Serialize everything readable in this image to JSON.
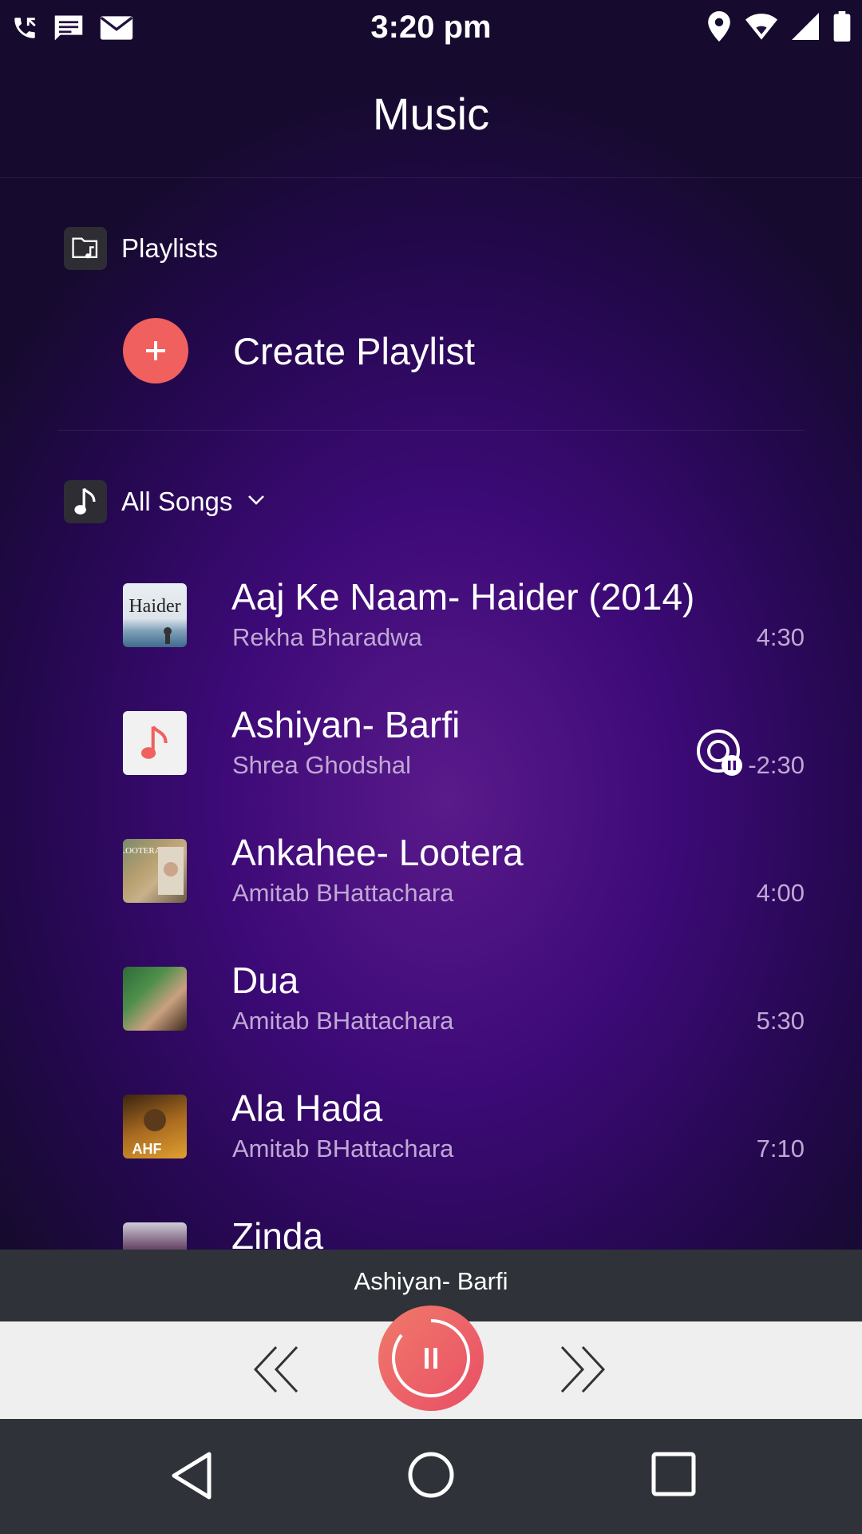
{
  "status_bar": {
    "time": "3:20 pm",
    "left_icons": [
      "phone-call-icon",
      "message-icon",
      "mail-icon"
    ],
    "right_icons": [
      "location-icon",
      "wifi-icon",
      "signal-icon",
      "battery-icon"
    ]
  },
  "app_bar": {
    "title": "Music"
  },
  "playlists": {
    "section_label": "Playlists",
    "create_label": "Create Playlist"
  },
  "songs_section": {
    "label": "All Songs"
  },
  "songs": [
    {
      "title": "Aaj Ke Naam- Haider (2014)",
      "artist": "Rekha Bharadwa",
      "duration": "4:30"
    },
    {
      "title": "Ashiyan- Barfi",
      "artist": "Shrea Ghodshal",
      "duration": "-2:30",
      "playing": true
    },
    {
      "title": "Ankahee- Lootera",
      "artist": "Amitab BHattachara",
      "duration": "4:00"
    },
    {
      "title": "Dua",
      "artist": "Amitab BHattachara",
      "duration": "5:30"
    },
    {
      "title": "Ala Hada",
      "artist": "Amitab BHattachara",
      "duration": "7:10"
    },
    {
      "title": "Zinda",
      "artist": "",
      "duration": ""
    }
  ],
  "now_playing": {
    "title": "Ashiyan- Barfi"
  },
  "colors": {
    "accent": "#f0605e",
    "background": "#3d0a78",
    "bar": "#2f3238",
    "controls": "#efefef"
  }
}
